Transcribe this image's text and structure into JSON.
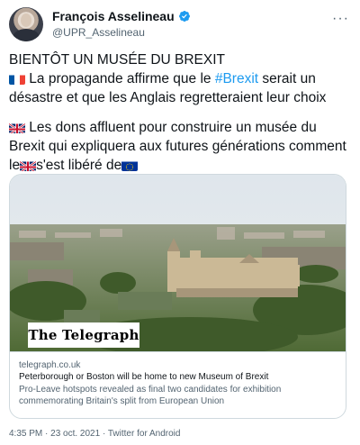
{
  "author": {
    "name": "François Asselineau",
    "handle": "@UPR_Asselineau",
    "more_icon": "three-dots-icon"
  },
  "tweet": {
    "line_title": "BIENTÔT UN MUSÉE DU BREXIT",
    "p1_before": " La propagande affirme que le ",
    "p1_hashtag": "#Brexit",
    "p1_after": " serait un désastre et que les Anglais regretteraient leur choix",
    "p2_main": " Les dons affluent pour construire un musée du Brexit qui expliquera aux futures générations comment le",
    "p2_mid": "s'est libéré de",
    "flags": [
      "france-flag",
      "uk-flag",
      "uk-flag",
      "eu-flag"
    ]
  },
  "card": {
    "logo_text": "The Telegraph",
    "domain": "telegraph.co.uk",
    "title": "Peterborough or Boston will be home to new Museum of Brexit",
    "description": "Pro-Leave hotspots revealed as final two candidates for exhibition commemorating Britain's split from European Union"
  },
  "meta": {
    "timestamp": "4:35 PM · 23 oct. 2021 · Twitter for Android"
  },
  "colors": {
    "link": "#1d9bf0",
    "secondary_text": "#536471",
    "verified": "#1d9bf0",
    "border": "#cfd9de"
  }
}
